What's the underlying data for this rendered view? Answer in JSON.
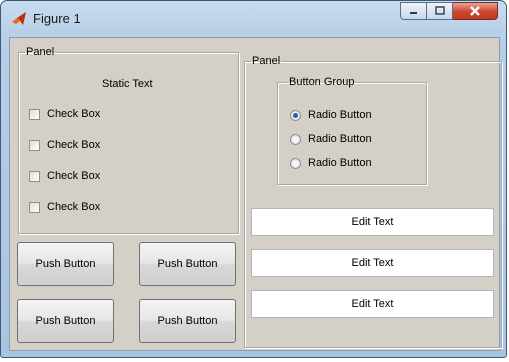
{
  "window": {
    "title": "Figure 1",
    "app_icon": "matlab-icon",
    "controls": {
      "minimize": "minimize-icon",
      "maximize": "maximize-icon",
      "close": "close-icon"
    }
  },
  "left_panel": {
    "title": "Panel",
    "static_text": "Static Text",
    "checkboxes": [
      {
        "label": "Check Box",
        "checked": false
      },
      {
        "label": "Check Box",
        "checked": false
      },
      {
        "label": "Check Box",
        "checked": false
      },
      {
        "label": "Check Box",
        "checked": false
      }
    ]
  },
  "push_buttons": [
    "Push Button",
    "Push Button",
    "Push Button",
    "Push Button"
  ],
  "right_panel": {
    "title": "Panel",
    "button_group": {
      "title": "Button Group",
      "radios": [
        {
          "label": "Radio Button",
          "selected": true
        },
        {
          "label": "Radio Button",
          "selected": false
        },
        {
          "label": "Radio Button",
          "selected": false
        }
      ]
    },
    "edit_texts": [
      "Edit Text",
      "Edit Text",
      "Edit Text"
    ]
  },
  "colors": {
    "client_bg": "#d4d0c8",
    "radio_accent": "#1f5fb0",
    "close_button": "#c9452b"
  }
}
